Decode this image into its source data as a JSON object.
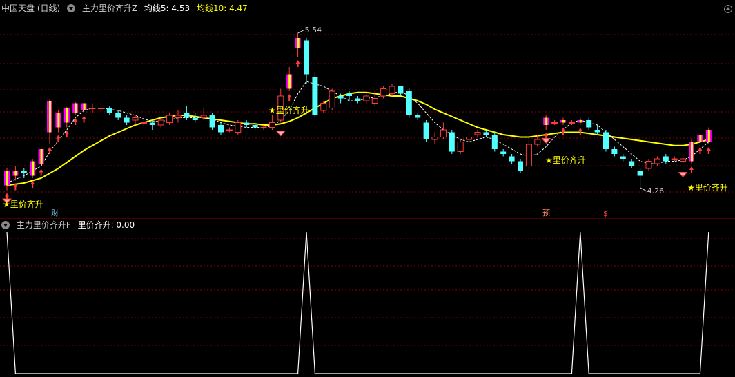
{
  "header_top": {
    "stock": "中国天盘 (日线)",
    "indicator": "主力里价齐升Z",
    "ma5_label": "均线5: 4.53",
    "ma10_label": "均线10: 4.47"
  },
  "header_bottom": {
    "indicator": "主力里价齐升F",
    "value_label": "里价齐升: 0.00"
  },
  "annotations": {
    "high_label": "5.54",
    "low_label": "4.26",
    "signal_text": "★里价齐升",
    "badge_cai": "财",
    "badge_yu": "预",
    "badge_s": "$"
  },
  "colors": {
    "up": "#ff3c3c",
    "down": "#54ffff",
    "ma5": "#ffffff",
    "ma10": "#ffff00",
    "signal_bar": "#ff00ff",
    "signal_star": "#ffff00",
    "grid": "#8b0000",
    "osc_line": "#ffffff"
  },
  "chart_data": [
    {
      "type": "candlestick",
      "title": "",
      "ylim": [
        4.1,
        5.7
      ],
      "candles": [
        {
          "o": 4.28,
          "c": 4.4,
          "h": 4.42,
          "l": 4.24,
          "sig": true
        },
        {
          "o": 4.36,
          "c": 4.4,
          "h": 4.44,
          "l": 4.32,
          "sig": true
        },
        {
          "o": 4.4,
          "c": 4.38,
          "h": 4.42,
          "l": 4.34,
          "sig": false
        },
        {
          "o": 4.36,
          "c": 4.48,
          "h": 4.5,
          "l": 4.34,
          "sig": true
        },
        {
          "o": 4.46,
          "c": 4.58,
          "h": 4.6,
          "l": 4.44,
          "sig": true
        },
        {
          "o": 4.72,
          "c": 4.98,
          "h": 4.99,
          "l": 4.62,
          "sig": true
        },
        {
          "o": 4.76,
          "c": 4.88,
          "h": 4.9,
          "l": 4.72,
          "sig": true
        },
        {
          "o": 4.8,
          "c": 4.92,
          "h": 4.93,
          "l": 4.76,
          "sig": true
        },
        {
          "o": 4.88,
          "c": 4.96,
          "h": 4.97,
          "l": 4.86,
          "sig": true
        },
        {
          "o": 4.9,
          "c": 4.96,
          "h": 5.0,
          "l": 4.88,
          "sig": true
        },
        {
          "o": 4.92,
          "c": 4.92,
          "h": 4.96,
          "l": 4.88,
          "sig": false
        },
        {
          "o": 4.92,
          "c": 4.92,
          "h": 4.94,
          "l": 4.9,
          "sig": false
        },
        {
          "o": 4.92,
          "c": 4.88,
          "h": 4.94,
          "l": 4.86,
          "sig": false
        },
        {
          "o": 4.88,
          "c": 4.84,
          "h": 4.9,
          "l": 4.82,
          "sig": false
        },
        {
          "o": 4.84,
          "c": 4.8,
          "h": 4.86,
          "l": 4.78,
          "sig": false
        },
        {
          "o": 4.82,
          "c": 4.84,
          "h": 4.86,
          "l": 4.78,
          "sig": false
        },
        {
          "o": 4.8,
          "c": 4.8,
          "h": 4.84,
          "l": 4.76,
          "sig": false
        },
        {
          "o": 4.8,
          "c": 4.78,
          "h": 4.82,
          "l": 4.74,
          "sig": false
        },
        {
          "o": 4.78,
          "c": 4.82,
          "h": 4.84,
          "l": 4.76,
          "sig": false
        },
        {
          "o": 4.8,
          "c": 4.86,
          "h": 4.88,
          "l": 4.78,
          "sig": false
        },
        {
          "o": 4.84,
          "c": 4.86,
          "h": 4.9,
          "l": 4.8,
          "sig": false
        },
        {
          "o": 4.88,
          "c": 4.84,
          "h": 4.94,
          "l": 4.82,
          "sig": false
        },
        {
          "o": 4.84,
          "c": 4.82,
          "h": 4.88,
          "l": 4.8,
          "sig": false
        },
        {
          "o": 4.84,
          "c": 4.86,
          "h": 4.92,
          "l": 4.82,
          "sig": false
        },
        {
          "o": 4.86,
          "c": 4.76,
          "h": 4.88,
          "l": 4.74,
          "sig": false
        },
        {
          "o": 4.78,
          "c": 4.72,
          "h": 4.8,
          "l": 4.7,
          "sig": false
        },
        {
          "o": 4.74,
          "c": 4.74,
          "h": 4.76,
          "l": 4.72,
          "sig": false
        },
        {
          "o": 4.72,
          "c": 4.8,
          "h": 4.82,
          "l": 4.7,
          "sig": false
        },
        {
          "o": 4.8,
          "c": 4.78,
          "h": 4.82,
          "l": 4.76,
          "sig": false
        },
        {
          "o": 4.78,
          "c": 4.76,
          "h": 4.8,
          "l": 4.74,
          "sig": false
        },
        {
          "o": 4.76,
          "c": 4.76,
          "h": 4.78,
          "l": 4.74,
          "sig": false
        },
        {
          "o": 4.76,
          "c": 4.8,
          "h": 4.86,
          "l": 4.74,
          "sig": false
        },
        {
          "o": 4.82,
          "c": 5.02,
          "h": 5.08,
          "l": 4.8,
          "sig": false
        },
        {
          "o": 5.08,
          "c": 5.2,
          "h": 5.26,
          "l": 5.06,
          "sig": true
        },
        {
          "o": 5.42,
          "c": 5.5,
          "h": 5.54,
          "l": 5.34,
          "sig": true
        },
        {
          "o": 5.48,
          "c": 5.2,
          "h": 5.5,
          "l": 5.12,
          "sig": false
        },
        {
          "o": 5.18,
          "c": 4.86,
          "h": 5.22,
          "l": 4.84,
          "sig": false
        },
        {
          "o": 4.9,
          "c": 4.96,
          "h": 4.98,
          "l": 4.88,
          "sig": false
        },
        {
          "o": 4.92,
          "c": 5.06,
          "h": 5.08,
          "l": 4.9,
          "sig": false
        },
        {
          "o": 5.02,
          "c": 5.0,
          "h": 5.04,
          "l": 4.96,
          "sig": false
        },
        {
          "o": 5.04,
          "c": 5.02,
          "h": 5.06,
          "l": 4.98,
          "sig": false
        },
        {
          "o": 5.0,
          "c": 4.98,
          "h": 5.02,
          "l": 4.96,
          "sig": false
        },
        {
          "o": 4.98,
          "c": 5.02,
          "h": 5.04,
          "l": 4.96,
          "sig": false
        },
        {
          "o": 4.96,
          "c": 5.0,
          "h": 5.06,
          "l": 4.94,
          "sig": false
        },
        {
          "o": 5.02,
          "c": 5.08,
          "h": 5.1,
          "l": 5.0,
          "sig": false
        },
        {
          "o": 5.04,
          "c": 5.1,
          "h": 5.12,
          "l": 5.02,
          "sig": false
        },
        {
          "o": 5.1,
          "c": 5.04,
          "h": 5.1,
          "l": 5.02,
          "sig": false
        },
        {
          "o": 5.06,
          "c": 4.86,
          "h": 5.08,
          "l": 4.84,
          "sig": false
        },
        {
          "o": 4.86,
          "c": 4.84,
          "h": 4.88,
          "l": 4.82,
          "sig": false
        },
        {
          "o": 4.8,
          "c": 4.66,
          "h": 4.82,
          "l": 4.64,
          "sig": false
        },
        {
          "o": 4.66,
          "c": 4.68,
          "h": 4.72,
          "l": 4.62,
          "sig": false
        },
        {
          "o": 4.68,
          "c": 4.74,
          "h": 4.8,
          "l": 4.66,
          "sig": false
        },
        {
          "o": 4.72,
          "c": 4.56,
          "h": 4.74,
          "l": 4.54,
          "sig": false
        },
        {
          "o": 4.56,
          "c": 4.64,
          "h": 4.66,
          "l": 4.54,
          "sig": false
        },
        {
          "o": 4.66,
          "c": 4.68,
          "h": 4.72,
          "l": 4.62,
          "sig": false
        },
        {
          "o": 4.7,
          "c": 4.72,
          "h": 4.74,
          "l": 4.68,
          "sig": false
        },
        {
          "o": 4.72,
          "c": 4.7,
          "h": 4.74,
          "l": 4.68,
          "sig": false
        },
        {
          "o": 4.7,
          "c": 4.58,
          "h": 4.72,
          "l": 4.56,
          "sig": false
        },
        {
          "o": 4.56,
          "c": 4.54,
          "h": 4.58,
          "l": 4.52,
          "sig": false
        },
        {
          "o": 4.52,
          "c": 4.48,
          "h": 4.54,
          "l": 4.46,
          "sig": false
        },
        {
          "o": 4.48,
          "c": 4.4,
          "h": 4.5,
          "l": 4.38,
          "sig": false
        },
        {
          "o": 4.44,
          "c": 4.62,
          "h": 4.66,
          "l": 4.4,
          "sig": false
        },
        {
          "o": 4.62,
          "c": 4.66,
          "h": 4.7,
          "l": 4.6,
          "sig": false
        },
        {
          "o": 4.78,
          "c": 4.84,
          "h": 4.86,
          "l": 4.74,
          "sig": true
        },
        {
          "o": 4.8,
          "c": 4.8,
          "h": 4.82,
          "l": 4.78,
          "sig": false
        },
        {
          "o": 4.8,
          "c": 4.82,
          "h": 4.84,
          "l": 4.78,
          "sig": true
        },
        {
          "o": 4.8,
          "c": 4.8,
          "h": 4.82,
          "l": 4.78,
          "sig": false
        },
        {
          "o": 4.8,
          "c": 4.82,
          "h": 4.84,
          "l": 4.78,
          "sig": true
        },
        {
          "o": 4.82,
          "c": 4.76,
          "h": 4.84,
          "l": 4.74,
          "sig": false
        },
        {
          "o": 4.74,
          "c": 4.72,
          "h": 4.78,
          "l": 4.7,
          "sig": false
        },
        {
          "o": 4.72,
          "c": 4.58,
          "h": 4.74,
          "l": 4.56,
          "sig": false
        },
        {
          "o": 4.58,
          "c": 4.54,
          "h": 4.6,
          "l": 4.52,
          "sig": false
        },
        {
          "o": 4.52,
          "c": 4.5,
          "h": 4.54,
          "l": 4.48,
          "sig": false
        },
        {
          "o": 4.48,
          "c": 4.44,
          "h": 4.5,
          "l": 4.42,
          "sig": false
        },
        {
          "o": 4.4,
          "c": 4.36,
          "h": 4.42,
          "l": 4.26,
          "sig": false
        },
        {
          "o": 4.42,
          "c": 4.48,
          "h": 4.5,
          "l": 4.4,
          "sig": false
        },
        {
          "o": 4.46,
          "c": 4.5,
          "h": 4.52,
          "l": 4.44,
          "sig": false
        },
        {
          "o": 4.52,
          "c": 4.48,
          "h": 4.54,
          "l": 4.46,
          "sig": false
        },
        {
          "o": 4.5,
          "c": 4.5,
          "h": 4.52,
          "l": 4.48,
          "sig": false
        },
        {
          "o": 4.48,
          "c": 4.5,
          "h": 4.52,
          "l": 4.46,
          "sig": false
        },
        {
          "o": 4.48,
          "c": 4.64,
          "h": 4.66,
          "l": 4.46,
          "sig": true
        },
        {
          "o": 4.64,
          "c": 4.7,
          "h": 4.72,
          "l": 4.62,
          "sig": true
        },
        {
          "o": 4.64,
          "c": 4.74,
          "h": 4.76,
          "l": 4.62,
          "sig": true
        }
      ],
      "ma5": [
        4.3,
        4.33,
        4.36,
        4.4,
        4.44,
        4.56,
        4.65,
        4.74,
        4.84,
        4.9,
        4.92,
        4.92,
        4.91,
        4.9,
        4.88,
        4.86,
        4.83,
        4.81,
        4.81,
        4.82,
        4.84,
        4.84,
        4.84,
        4.84,
        4.83,
        4.8,
        4.78,
        4.77,
        4.76,
        4.76,
        4.76,
        4.77,
        4.82,
        4.9,
        5.04,
        5.14,
        5.12,
        5.1,
        5.06,
        5.02,
        4.98,
        4.98,
        5.0,
        5.01,
        5.02,
        5.04,
        5.06,
        5.02,
        4.96,
        4.88,
        4.8,
        4.74,
        4.7,
        4.66,
        4.64,
        4.66,
        4.68,
        4.66,
        4.62,
        4.58,
        4.54,
        4.52,
        4.54,
        4.6,
        4.68,
        4.74,
        4.8,
        4.82,
        4.8,
        4.78,
        4.72,
        4.66,
        4.6,
        4.54,
        4.48,
        4.46,
        4.46,
        4.48,
        4.48,
        4.49,
        4.52,
        4.58,
        4.64
      ],
      "ma10": [
        4.28,
        4.29,
        4.3,
        4.32,
        4.34,
        4.38,
        4.42,
        4.47,
        4.52,
        4.57,
        4.61,
        4.65,
        4.69,
        4.72,
        4.75,
        4.78,
        4.8,
        4.82,
        4.84,
        4.85,
        4.86,
        4.86,
        4.85,
        4.84,
        4.83,
        4.82,
        4.81,
        4.8,
        4.79,
        4.79,
        4.78,
        4.78,
        4.79,
        4.81,
        4.84,
        4.88,
        4.92,
        4.96,
        5.0,
        5.02,
        5.04,
        5.05,
        5.05,
        5.04,
        5.03,
        5.02,
        5.02,
        5.0,
        4.98,
        4.95,
        4.91,
        4.88,
        4.85,
        4.82,
        4.79,
        4.76,
        4.74,
        4.72,
        4.7,
        4.69,
        4.68,
        4.68,
        4.69,
        4.7,
        4.71,
        4.72,
        4.72,
        4.72,
        4.71,
        4.7,
        4.69,
        4.68,
        4.67,
        4.66,
        4.65,
        4.64,
        4.63,
        4.62,
        4.61,
        4.61,
        4.62,
        4.64,
        4.66
      ],
      "high_label_index": 34,
      "low_label_index": 74,
      "signal_text_indices": [
        0,
        35,
        67,
        82
      ]
    },
    {
      "type": "line",
      "title": "",
      "ylim": [
        0,
        1
      ],
      "values": [
        1,
        0,
        0,
        0,
        0,
        0,
        0,
        0,
        0,
        0,
        0,
        0,
        0,
        0,
        0,
        0,
        0,
        0,
        0,
        0,
        0,
        0,
        0,
        0,
        0,
        0,
        0,
        0,
        0,
        0,
        0,
        0,
        0,
        0,
        0,
        1,
        0,
        0,
        0,
        0,
        0,
        0,
        0,
        0,
        0,
        0,
        0,
        0,
        0,
        0,
        0,
        0,
        0,
        0,
        0,
        0,
        0,
        0,
        0,
        0,
        0,
        0,
        0,
        0,
        0,
        0,
        0,
        1,
        0,
        0,
        0,
        0,
        0,
        0,
        0,
        0,
        0,
        0,
        0,
        0,
        0,
        0,
        1
      ]
    }
  ]
}
